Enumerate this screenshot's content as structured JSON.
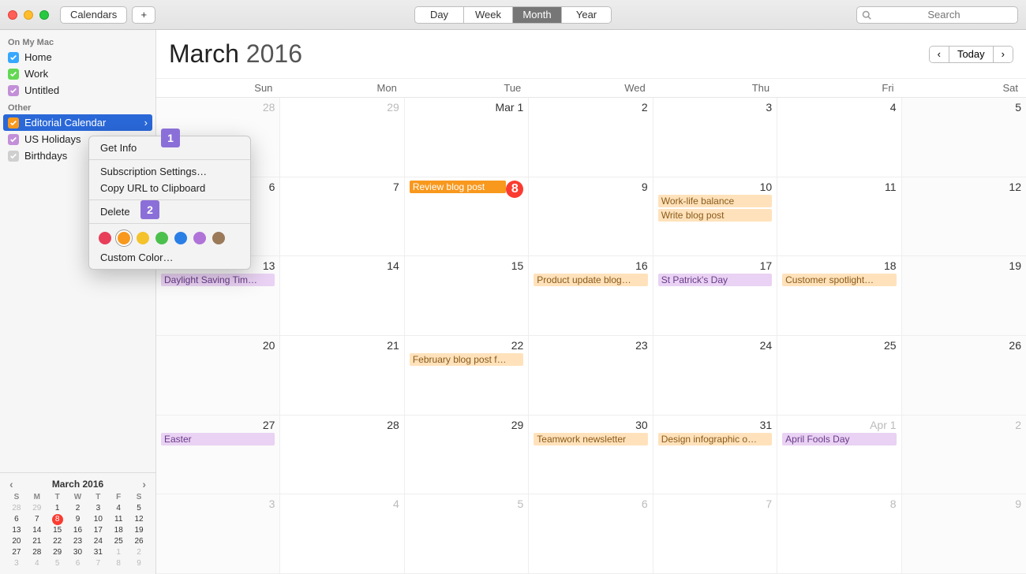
{
  "titlebar": {
    "calendars_button": "Calendars",
    "views": [
      "Day",
      "Week",
      "Month",
      "Year"
    ],
    "active_view": "Month",
    "search_placeholder": "Search"
  },
  "sidebar": {
    "sections": [
      {
        "title": "On My Mac",
        "items": [
          {
            "label": "Home",
            "color": "blue",
            "checked": true
          },
          {
            "label": "Work",
            "color": "green",
            "checked": true
          },
          {
            "label": "Untitled",
            "color": "purple",
            "checked": true
          }
        ]
      },
      {
        "title": "Other",
        "items": [
          {
            "label": "Editorial Calendar",
            "color": "orange",
            "checked": true,
            "selected": true
          },
          {
            "label": "US Holidays",
            "color": "purple",
            "checked": true
          },
          {
            "label": "Birthdays",
            "color": "gray",
            "checked": true
          }
        ]
      }
    ]
  },
  "context_menu": {
    "get_info": "Get Info",
    "subscription": "Subscription Settings…",
    "copy_url": "Copy URL to Clipboard",
    "delete": "Delete",
    "custom_color": "Custom Color…",
    "colors": [
      "#e83e5a",
      "#f8981d",
      "#f4c22b",
      "#4cc04c",
      "#2a7fe6",
      "#b073d8",
      "#9b7a5a"
    ],
    "selected_color_index": 1
  },
  "annotations": {
    "a1": "1",
    "a2": "2"
  },
  "header": {
    "month": "March",
    "year": "2016",
    "today_label": "Today"
  },
  "dow": [
    "Sun",
    "Mon",
    "Tue",
    "Wed",
    "Thu",
    "Fri",
    "Sat"
  ],
  "weeks": [
    [
      {
        "num": "28",
        "dim": true
      },
      {
        "num": "29",
        "dim": true
      },
      {
        "num": "Mar 1"
      },
      {
        "num": "2"
      },
      {
        "num": "3"
      },
      {
        "num": "4"
      },
      {
        "num": "5"
      }
    ],
    [
      {
        "num": "6"
      },
      {
        "num": "7"
      },
      {
        "num": "8",
        "today": true,
        "events": [
          {
            "t": "Review blog post",
            "c": "ev-orange"
          }
        ]
      },
      {
        "num": "9"
      },
      {
        "num": "10",
        "events": [
          {
            "t": "Work-life balance",
            "c": "ev-orange-l"
          },
          {
            "t": "Write blog post",
            "c": "ev-orange-l"
          }
        ]
      },
      {
        "num": "11"
      },
      {
        "num": "12"
      }
    ],
    [
      {
        "num": "13",
        "events": [
          {
            "t": "Daylight Saving Tim…",
            "c": "ev-purple-l"
          }
        ]
      },
      {
        "num": "14"
      },
      {
        "num": "15"
      },
      {
        "num": "16",
        "events": [
          {
            "t": "Product update blog…",
            "c": "ev-orange-l"
          }
        ]
      },
      {
        "num": "17",
        "events": [
          {
            "t": "St Patrick's Day",
            "c": "ev-purple-l"
          }
        ]
      },
      {
        "num": "18",
        "events": [
          {
            "t": "Customer spotlight…",
            "c": "ev-orange-l"
          }
        ]
      },
      {
        "num": "19"
      }
    ],
    [
      {
        "num": "20"
      },
      {
        "num": "21"
      },
      {
        "num": "22",
        "events": [
          {
            "t": "February blog post f…",
            "c": "ev-orange-l"
          }
        ]
      },
      {
        "num": "23"
      },
      {
        "num": "24"
      },
      {
        "num": "25"
      },
      {
        "num": "26"
      }
    ],
    [
      {
        "num": "27",
        "events": [
          {
            "t": "Easter",
            "c": "ev-purple-l"
          }
        ]
      },
      {
        "num": "28"
      },
      {
        "num": "29"
      },
      {
        "num": "30",
        "events": [
          {
            "t": "Teamwork newsletter",
            "c": "ev-orange-l"
          }
        ]
      },
      {
        "num": "31",
        "events": [
          {
            "t": "Design infographic o…",
            "c": "ev-orange-l"
          }
        ]
      },
      {
        "num": "Apr 1",
        "apr": true,
        "events": [
          {
            "t": "April Fools Day",
            "c": "ev-purple-l"
          }
        ]
      },
      {
        "num": "2",
        "apr": true
      }
    ],
    [
      {
        "num": "3",
        "apr": true
      },
      {
        "num": "4",
        "apr": true
      },
      {
        "num": "5",
        "apr": true
      },
      {
        "num": "6",
        "apr": true
      },
      {
        "num": "7",
        "apr": true
      },
      {
        "num": "8",
        "apr": true
      },
      {
        "num": "9",
        "apr": true
      }
    ]
  ],
  "mini": {
    "title": "March 2016",
    "dow": [
      "S",
      "M",
      "T",
      "W",
      "T",
      "F",
      "S"
    ],
    "rows": [
      [
        {
          "n": "28",
          "d": 1
        },
        {
          "n": "29",
          "d": 1
        },
        {
          "n": "1"
        },
        {
          "n": "2"
        },
        {
          "n": "3"
        },
        {
          "n": "4"
        },
        {
          "n": "5"
        }
      ],
      [
        {
          "n": "6"
        },
        {
          "n": "7"
        },
        {
          "n": "8",
          "t": 1
        },
        {
          "n": "9"
        },
        {
          "n": "10"
        },
        {
          "n": "11"
        },
        {
          "n": "12"
        }
      ],
      [
        {
          "n": "13"
        },
        {
          "n": "14"
        },
        {
          "n": "15"
        },
        {
          "n": "16"
        },
        {
          "n": "17"
        },
        {
          "n": "18"
        },
        {
          "n": "19"
        }
      ],
      [
        {
          "n": "20"
        },
        {
          "n": "21"
        },
        {
          "n": "22"
        },
        {
          "n": "23"
        },
        {
          "n": "24"
        },
        {
          "n": "25"
        },
        {
          "n": "26"
        }
      ],
      [
        {
          "n": "27"
        },
        {
          "n": "28"
        },
        {
          "n": "29"
        },
        {
          "n": "30"
        },
        {
          "n": "31"
        },
        {
          "n": "1",
          "d": 1
        },
        {
          "n": "2",
          "d": 1
        }
      ],
      [
        {
          "n": "3",
          "d": 1
        },
        {
          "n": "4",
          "d": 1
        },
        {
          "n": "5",
          "d": 1
        },
        {
          "n": "6",
          "d": 1
        },
        {
          "n": "7",
          "d": 1
        },
        {
          "n": "8",
          "d": 1
        },
        {
          "n": "9",
          "d": 1
        }
      ]
    ]
  }
}
